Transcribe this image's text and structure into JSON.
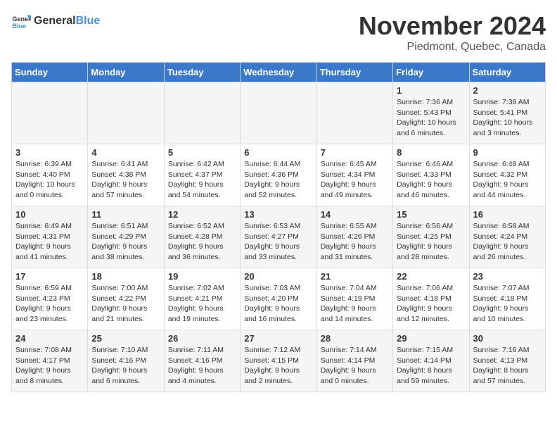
{
  "header": {
    "logo_general": "General",
    "logo_blue": "Blue",
    "month": "November 2024",
    "location": "Piedmont, Quebec, Canada"
  },
  "days_of_week": [
    "Sunday",
    "Monday",
    "Tuesday",
    "Wednesday",
    "Thursday",
    "Friday",
    "Saturday"
  ],
  "weeks": [
    [
      {
        "day": "",
        "info": ""
      },
      {
        "day": "",
        "info": ""
      },
      {
        "day": "",
        "info": ""
      },
      {
        "day": "",
        "info": ""
      },
      {
        "day": "",
        "info": ""
      },
      {
        "day": "1",
        "info": "Sunrise: 7:36 AM\nSunset: 5:43 PM\nDaylight: 10 hours and 6 minutes."
      },
      {
        "day": "2",
        "info": "Sunrise: 7:38 AM\nSunset: 5:41 PM\nDaylight: 10 hours and 3 minutes."
      }
    ],
    [
      {
        "day": "3",
        "info": "Sunrise: 6:39 AM\nSunset: 4:40 PM\nDaylight: 10 hours and 0 minutes."
      },
      {
        "day": "4",
        "info": "Sunrise: 6:41 AM\nSunset: 4:38 PM\nDaylight: 9 hours and 57 minutes."
      },
      {
        "day": "5",
        "info": "Sunrise: 6:42 AM\nSunset: 4:37 PM\nDaylight: 9 hours and 54 minutes."
      },
      {
        "day": "6",
        "info": "Sunrise: 6:44 AM\nSunset: 4:36 PM\nDaylight: 9 hours and 52 minutes."
      },
      {
        "day": "7",
        "info": "Sunrise: 6:45 AM\nSunset: 4:34 PM\nDaylight: 9 hours and 49 minutes."
      },
      {
        "day": "8",
        "info": "Sunrise: 6:46 AM\nSunset: 4:33 PM\nDaylight: 9 hours and 46 minutes."
      },
      {
        "day": "9",
        "info": "Sunrise: 6:48 AM\nSunset: 4:32 PM\nDaylight: 9 hours and 44 minutes."
      }
    ],
    [
      {
        "day": "10",
        "info": "Sunrise: 6:49 AM\nSunset: 4:31 PM\nDaylight: 9 hours and 41 minutes."
      },
      {
        "day": "11",
        "info": "Sunrise: 6:51 AM\nSunset: 4:29 PM\nDaylight: 9 hours and 38 minutes."
      },
      {
        "day": "12",
        "info": "Sunrise: 6:52 AM\nSunset: 4:28 PM\nDaylight: 9 hours and 36 minutes."
      },
      {
        "day": "13",
        "info": "Sunrise: 6:53 AM\nSunset: 4:27 PM\nDaylight: 9 hours and 33 minutes."
      },
      {
        "day": "14",
        "info": "Sunrise: 6:55 AM\nSunset: 4:26 PM\nDaylight: 9 hours and 31 minutes."
      },
      {
        "day": "15",
        "info": "Sunrise: 6:56 AM\nSunset: 4:25 PM\nDaylight: 9 hours and 28 minutes."
      },
      {
        "day": "16",
        "info": "Sunrise: 6:58 AM\nSunset: 4:24 PM\nDaylight: 9 hours and 26 minutes."
      }
    ],
    [
      {
        "day": "17",
        "info": "Sunrise: 6:59 AM\nSunset: 4:23 PM\nDaylight: 9 hours and 23 minutes."
      },
      {
        "day": "18",
        "info": "Sunrise: 7:00 AM\nSunset: 4:22 PM\nDaylight: 9 hours and 21 minutes."
      },
      {
        "day": "19",
        "info": "Sunrise: 7:02 AM\nSunset: 4:21 PM\nDaylight: 9 hours and 19 minutes."
      },
      {
        "day": "20",
        "info": "Sunrise: 7:03 AM\nSunset: 4:20 PM\nDaylight: 9 hours and 16 minutes."
      },
      {
        "day": "21",
        "info": "Sunrise: 7:04 AM\nSunset: 4:19 PM\nDaylight: 9 hours and 14 minutes."
      },
      {
        "day": "22",
        "info": "Sunrise: 7:06 AM\nSunset: 4:18 PM\nDaylight: 9 hours and 12 minutes."
      },
      {
        "day": "23",
        "info": "Sunrise: 7:07 AM\nSunset: 4:18 PM\nDaylight: 9 hours and 10 minutes."
      }
    ],
    [
      {
        "day": "24",
        "info": "Sunrise: 7:08 AM\nSunset: 4:17 PM\nDaylight: 9 hours and 8 minutes."
      },
      {
        "day": "25",
        "info": "Sunrise: 7:10 AM\nSunset: 4:16 PM\nDaylight: 9 hours and 6 minutes."
      },
      {
        "day": "26",
        "info": "Sunrise: 7:11 AM\nSunset: 4:16 PM\nDaylight: 9 hours and 4 minutes."
      },
      {
        "day": "27",
        "info": "Sunrise: 7:12 AM\nSunset: 4:15 PM\nDaylight: 9 hours and 2 minutes."
      },
      {
        "day": "28",
        "info": "Sunrise: 7:14 AM\nSunset: 4:14 PM\nDaylight: 9 hours and 0 minutes."
      },
      {
        "day": "29",
        "info": "Sunrise: 7:15 AM\nSunset: 4:14 PM\nDaylight: 8 hours and 59 minutes."
      },
      {
        "day": "30",
        "info": "Sunrise: 7:16 AM\nSunset: 4:13 PM\nDaylight: 8 hours and 57 minutes."
      }
    ]
  ]
}
